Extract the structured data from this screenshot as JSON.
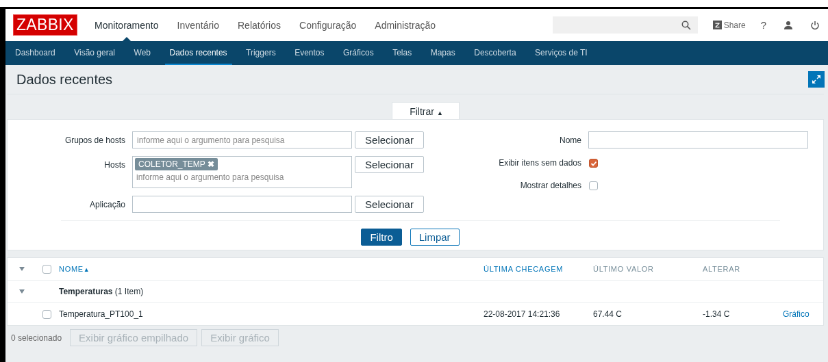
{
  "header": {
    "logo": "ZABBIX",
    "menu": [
      {
        "label": "Monitoramento",
        "selected": true
      },
      {
        "label": "Inventário",
        "selected": false
      },
      {
        "label": "Relatórios",
        "selected": false
      },
      {
        "label": "Configuração",
        "selected": false
      },
      {
        "label": "Administração",
        "selected": false
      }
    ],
    "share": "Share",
    "help": "?"
  },
  "subnav": [
    {
      "label": "Dashboard",
      "selected": false
    },
    {
      "label": "Visão geral",
      "selected": false
    },
    {
      "label": "Web",
      "selected": false
    },
    {
      "label": "Dados recentes",
      "selected": true
    },
    {
      "label": "Triggers",
      "selected": false
    },
    {
      "label": "Eventos",
      "selected": false
    },
    {
      "label": "Gráficos",
      "selected": false
    },
    {
      "label": "Telas",
      "selected": false
    },
    {
      "label": "Mapas",
      "selected": false
    },
    {
      "label": "Descoberta",
      "selected": false
    },
    {
      "label": "Serviços de TI",
      "selected": false
    }
  ],
  "page_title": "Dados recentes",
  "filter": {
    "tab": "Filtrar",
    "tab_arrow": "▲",
    "expanded": true,
    "left": [
      {
        "label": "Grupos de hosts",
        "placeholder": "informe aqui o argumento para pesquisa",
        "button": "Selecionar"
      },
      {
        "label": "Hosts",
        "tags": [
          "COLETOR_TEMP"
        ],
        "tag_remove": "✖",
        "placeholder": "informe aqui o argumento para pesquisa",
        "button": "Selecionar"
      },
      {
        "label": "Aplicação",
        "button": "Selecionar"
      }
    ],
    "name_label": "Nome",
    "checks": [
      {
        "label": "Exibir itens sem dados",
        "checked": true
      },
      {
        "label": "Mostrar detalhes",
        "checked": false
      }
    ],
    "apply": "Filtro",
    "reset": "Limpar"
  },
  "table": {
    "select_all": false,
    "columns": [
      {
        "label": "NOME",
        "sort": "▲",
        "active": true
      },
      {
        "label": "ÚLTIMA CHECAGEM",
        "active": true
      },
      {
        "label": "ÚLTIMO VALOR",
        "active": false
      },
      {
        "label": "ALTERAR",
        "active": false
      }
    ],
    "groups": [
      {
        "name": "Temperaturas",
        "count": "(1 Item)",
        "expanded": true,
        "rows": [
          {
            "name": "Temperatura_PT100_1",
            "checked": false,
            "last_check": "22-08-2017 14:21:36",
            "last_value": "67.44 C",
            "change": "-1.34 C",
            "link": "Gráfico"
          }
        ]
      }
    ]
  },
  "footer": {
    "selected": "0 selecionado",
    "buttons": [
      {
        "label": "Exibir gráfico empilhado",
        "disabled": true
      },
      {
        "label": "Exibir gráfico",
        "disabled": true
      }
    ]
  }
}
